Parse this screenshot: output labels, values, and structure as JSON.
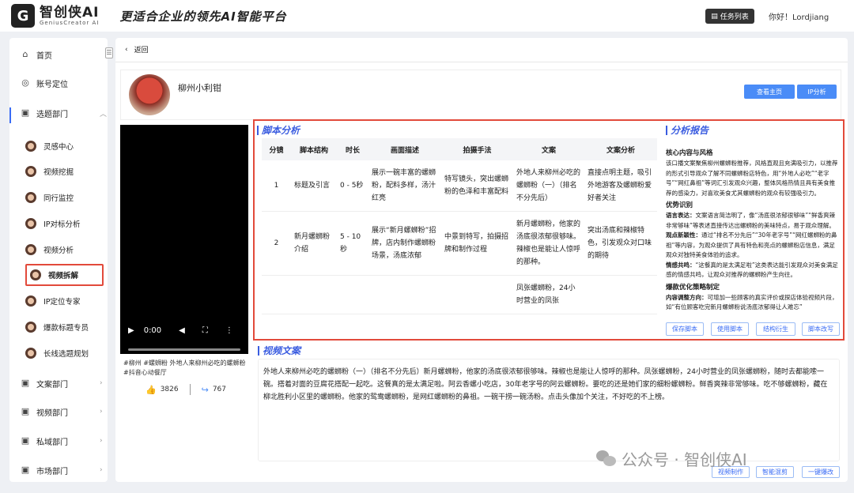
{
  "header": {
    "logo_mark": "G",
    "logo_title": "智创侠AI",
    "logo_sub": "GeniusCreator AI",
    "slogan": "更适合企业的领先AI智能平台",
    "task_button": "任务列表",
    "greeting": "你好！Lordjiang"
  },
  "sidebar": {
    "main_items": [
      {
        "label": "首页",
        "icon": "home-icon"
      },
      {
        "label": "账号定位",
        "icon": "target-icon"
      },
      {
        "label": "选题部门",
        "icon": "doc-icon"
      },
      {
        "label": "文案部门",
        "icon": "doc-icon"
      },
      {
        "label": "视频部门",
        "icon": "doc-icon"
      },
      {
        "label": "私域部门",
        "icon": "doc-icon"
      },
      {
        "label": "市场部门",
        "icon": "doc-icon"
      }
    ],
    "sub_items": [
      "灵感中心",
      "视频挖掘",
      "同行监控",
      "IP对标分析",
      "视频分析",
      "视频拆解",
      "IP定位专家",
      "爆款标题专员",
      "长线选题规划"
    ]
  },
  "main": {
    "back_label": "返回",
    "profile": {
      "name": "柳州小利钳",
      "view_home": "查看主页",
      "ip_analysis": "IP分析"
    },
    "video": {
      "time": "0:00",
      "caption": "#柳州 #螺蛳粉 外地人来柳州必吃的螺蛳粉 #抖音心动餐厅",
      "likes": "3826",
      "shares": "767"
    },
    "script_analysis": {
      "title": "脚本分析",
      "headers": [
        "分镜",
        "脚本结构",
        "时长",
        "画面描述",
        "拍摄手法",
        "文案",
        "文案分析"
      ],
      "rows": [
        [
          "1",
          "标题及引言",
          "0 - 5秒",
          "展示一碗丰富的螺蛳粉，配料多样，汤汁红亮",
          "特写镜头，突出螺蛳粉的色泽和丰富配料",
          "外地人来柳州必吃的螺蛳粉（一）（排名不分先后）",
          "直接点明主题，吸引外地游客及螺蛳粉爱好者关注"
        ],
        [
          "2",
          "新月螺蛳粉介绍",
          "5 - 10秒",
          "展示“新月螺蛳粉”招牌，店内制作螺蛳粉场景，汤底浓郁",
          "中景到特写，拍摄招牌和制作过程",
          "新月螺蛳粉，他家的汤底很浓郁很够味。辣椒也是能让人惊呼的那种。",
          "突出汤底和辣椒特色，引发观众对口味的期待"
        ],
        [
          "",
          "",
          "",
          "",
          "",
          "凤张螺蛳粉，24小时营业的凤张",
          ""
        ]
      ],
      "actions": [
        "保存脚本",
        "使用脚本",
        "结构衍生",
        "脚本改写"
      ]
    },
    "report": {
      "title": "分析报告",
      "h1": "核心内容与风格",
      "p1": "该口播文案聚焦柳州螺蛳粉推荐，风格直观且充满吸引力，以推荐的形式引导观众了解不同螺蛳粉店特色，用“外地人必吃”“老字号”“网红鼻祖”等词汇引发观众兴趣，整体风格热情且具有美食推荐的感染力，对喜欢美食尤其螺蛳粉的观众有较强吸引力。",
      "h2": "优势识别",
      "p2_label": "语言表达：",
      "p2": "文案语言简洁明了，像“汤底很浓郁很够味”“鲜香爽辣非常够味”等表述直接传达出螺蛳粉的美味特点，易于观众理解。",
      "p3_label": "观点新颖性：",
      "p3": "通过“排名不分先后”“30年老字号”“网红螺蛳粉的鼻祖”等内容，为观众提供了具有特色和亮点的螺蛳粉店信息，满足观众对独特美食体验的追求。",
      "p4_label": "情感共鸣：",
      "p4": "“这餐真的是太满足啦”这类表达能引发观众对美食满足感的情感共鸣，让观众对推荐的螺蛳粉产生向往。",
      "h3": "爆款优化策略制定",
      "p5_label": "内容调整方向：",
      "p5": "可增加一些顾客的真实评价或探店体验视频片段，如“有位顾客吃完新月螺蛳粉说汤底浓郁得让人难忘”"
    },
    "copy": {
      "title": "视频文案",
      "text": "外地人来柳州必吃的螺蛳粉（一）（排名不分先后）新月螺蛳粉，他家的汤底很浓郁很够味。辣椒也是能让人惊呼的那种。凤张螺蛳粉，24小时营业的凤张螺蛳粉，随时去都能嗦一碗。搭着对面的豆腐花搭配一起吃。这餐真的是太满足啦。阿云香螺小吃店，30年老字号的阿云螺蛳粉。要吃的还是她们家的细粉螺蛳粉。鲜香爽辣非常够味。吃不够螺蛳粉，藏在柳北胜利小区里的螺蛳粉。他家的鸳鸯螺蛳粉，是网红螺蛳粉的鼻祖。一碗干捞一碗汤粉。点击头像加个关注，不好吃的不上榜。",
      "actions": [
        "视频制作",
        "智能混剪",
        "一键爆改"
      ]
    }
  },
  "watermark": "公众号 · 智创侠AI"
}
